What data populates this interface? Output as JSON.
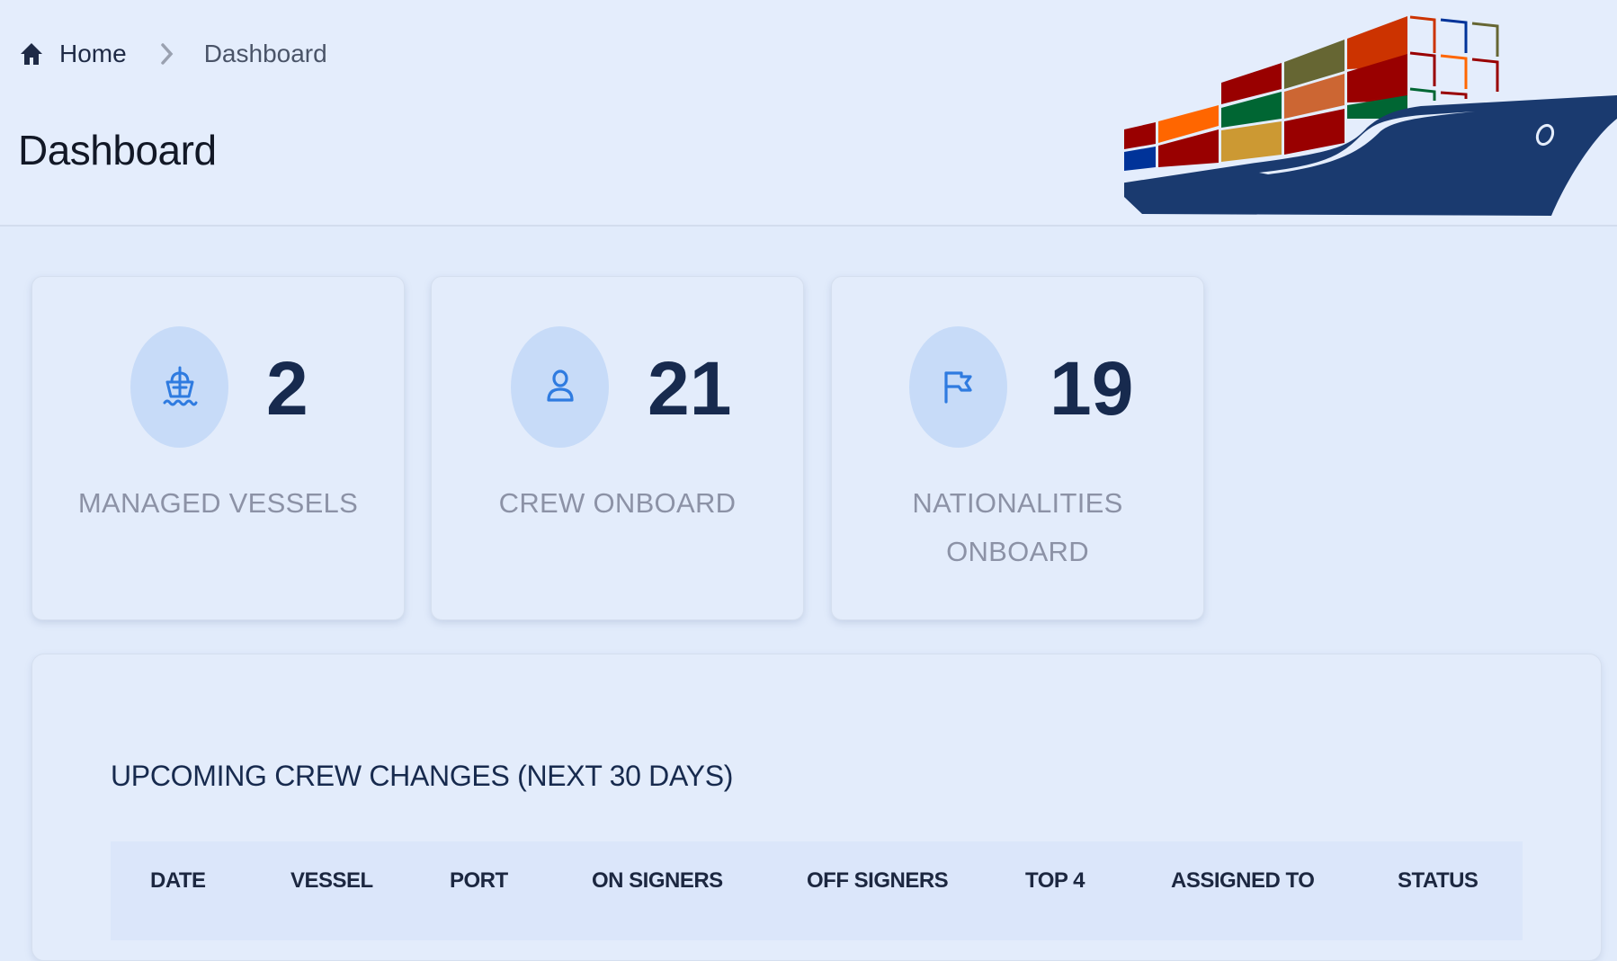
{
  "breadcrumb": {
    "home_icon": "home-icon",
    "home_label": "Home",
    "separator_icon": "chevron-right-icon",
    "current_label": "Dashboard"
  },
  "page": {
    "title": "Dashboard",
    "banner_image": "container-ship-illustration"
  },
  "colors": {
    "accent": "#2f7be0",
    "stat_value": "#172a4e",
    "ship_hull": "#1a3a6f",
    "background": "#e1ebfb"
  },
  "stats": [
    {
      "icon": "ship-icon",
      "value": "2",
      "label": "MANAGED VESSELS"
    },
    {
      "icon": "user-icon",
      "value": "21",
      "label": "CREW ONBOARD"
    },
    {
      "icon": "flag-icon",
      "value": "19",
      "label_line1": "NATIONALITIES",
      "label_line2": "ONBOARD"
    }
  ],
  "crew_changes": {
    "title": "UPCOMING CREW CHANGES (NEXT 30 DAYS)",
    "columns": [
      "DATE",
      "VESSEL",
      "PORT",
      "ON SIGNERS",
      "OFF SIGNERS",
      "TOP 4",
      "ASSIGNED TO",
      "STATUS"
    ]
  }
}
